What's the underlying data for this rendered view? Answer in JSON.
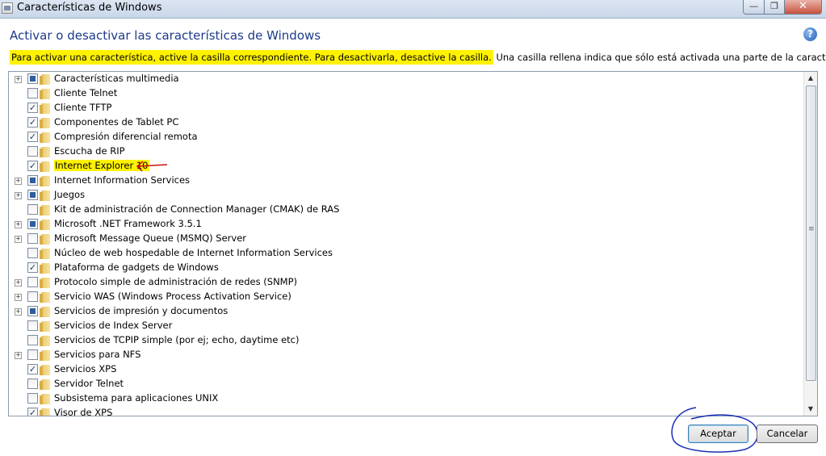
{
  "window": {
    "title": "Características de Windows",
    "controls": {
      "minimize": "—",
      "maximize": "❐",
      "close": "✕"
    }
  },
  "heading": "Activar o desactivar las características de Windows",
  "instructions": {
    "highlighted": "Para activar una característica, active la casilla correspondiente. Para desactivarla, desactive la casilla.",
    "rest": " Una casilla rellena indica que sólo está activada una parte de la característica."
  },
  "features": [
    {
      "label": "Características multimedia",
      "state": "partial",
      "expandable": true
    },
    {
      "label": "Cliente Telnet",
      "state": "unchecked",
      "expandable": false
    },
    {
      "label": "Cliente TFTP",
      "state": "checked",
      "expandable": false
    },
    {
      "label": "Componentes de Tablet PC",
      "state": "checked",
      "expandable": false
    },
    {
      "label": "Compresión diferencial remota",
      "state": "checked",
      "expandable": false
    },
    {
      "label": "Escucha de RIP",
      "state": "unchecked",
      "expandable": false
    },
    {
      "label": "Internet Explorer 10",
      "state": "checked",
      "expandable": false,
      "highlighted": true
    },
    {
      "label": "Internet Information Services",
      "state": "partial",
      "expandable": true
    },
    {
      "label": "Juegos",
      "state": "partial",
      "expandable": true
    },
    {
      "label": "Kit de administración de Connection Manager (CMAK) de RAS",
      "state": "unchecked",
      "expandable": false
    },
    {
      "label": "Microsoft .NET Framework 3.5.1",
      "state": "partial",
      "expandable": true
    },
    {
      "label": "Microsoft Message Queue (MSMQ) Server",
      "state": "unchecked",
      "expandable": true
    },
    {
      "label": "Núcleo de web hospedable de Internet Information Services",
      "state": "unchecked",
      "expandable": false
    },
    {
      "label": "Plataforma de gadgets de Windows",
      "state": "checked",
      "expandable": false
    },
    {
      "label": "Protocolo simple de administración de redes (SNMP)",
      "state": "unchecked",
      "expandable": true
    },
    {
      "label": "Servicio WAS (Windows Process Activation Service)",
      "state": "unchecked",
      "expandable": true
    },
    {
      "label": "Servicios de impresión y documentos",
      "state": "partial",
      "expandable": true
    },
    {
      "label": "Servicios de Index Server",
      "state": "unchecked",
      "expandable": false
    },
    {
      "label": "Servicios de TCPIP simple (por ej; echo, daytime etc)",
      "state": "unchecked",
      "expandable": false
    },
    {
      "label": "Servicios para NFS",
      "state": "unchecked",
      "expandable": true
    },
    {
      "label": "Servicios XPS",
      "state": "checked",
      "expandable": false
    },
    {
      "label": "Servidor Telnet",
      "state": "unchecked",
      "expandable": false
    },
    {
      "label": "Subsistema para aplicaciones UNIX",
      "state": "unchecked",
      "expandable": false
    },
    {
      "label": "Visor de XPS",
      "state": "checked",
      "expandable": false
    }
  ],
  "buttons": {
    "ok": "Aceptar",
    "cancel": "Cancelar"
  },
  "colors": {
    "highlight": "#fff200",
    "heading": "#1e3a8a",
    "annotation_red": "#cc1111",
    "annotation_blue": "#1a2fb8"
  }
}
